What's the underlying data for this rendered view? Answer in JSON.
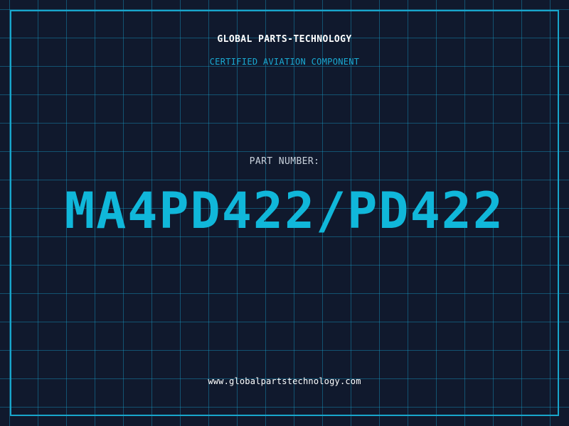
{
  "brand": {
    "title": "GLOBAL PARTS-TECHNOLOGY",
    "subtitle": "CERTIFIED AVIATION COMPONENT"
  },
  "part": {
    "label": "PART NUMBER:",
    "number": "MA4PD422/PD422"
  },
  "footer": {
    "website": "www.globalpartstechnology.com"
  },
  "colors": {
    "background": "#10192d",
    "accent": "#10b7da",
    "grid": "#18a0cd",
    "text": "#ffffff",
    "label": "#c9d2dd"
  }
}
